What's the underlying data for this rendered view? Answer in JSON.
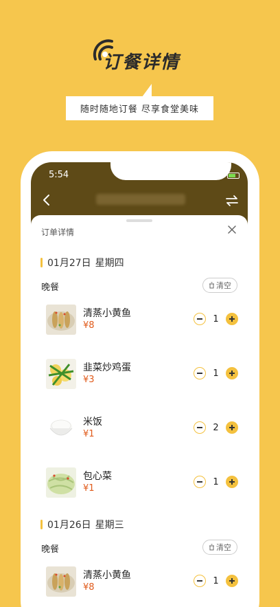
{
  "promo": {
    "title": "订餐详情",
    "subtitle": "随时随地订餐  尽享食堂美味"
  },
  "status_bar": {
    "time": "5:54",
    "network": "4G"
  },
  "nav": {
    "back_icon": "chevron-left-icon",
    "switch_icon": "swap-icon"
  },
  "sheet": {
    "title": "订单详情",
    "close_icon": "close-icon",
    "days": [
      {
        "date": "01月27日",
        "weekday": "星期四",
        "meal": "晚餐",
        "clear_label": "清空",
        "items": [
          {
            "name": "清蒸小黄鱼",
            "price": "¥8",
            "qty": "1",
            "image": "steamed-fish"
          },
          {
            "name": "韭菜炒鸡蛋",
            "price": "¥3",
            "qty": "1",
            "image": "chive-egg"
          },
          {
            "name": "米饭",
            "price": "¥1",
            "qty": "2",
            "image": "rice"
          },
          {
            "name": "包心菜",
            "price": "¥1",
            "qty": "1",
            "image": "cabbage"
          }
        ]
      },
      {
        "date": "01月26日",
        "weekday": "星期三",
        "meal": "晚餐",
        "clear_label": "清空",
        "items": [
          {
            "name": "清蒸小黄鱼",
            "price": "¥8",
            "qty": "1",
            "image": "steamed-fish"
          }
        ]
      }
    ]
  },
  "colors": {
    "background": "#f6c64d",
    "accent": "#f4c13e",
    "header": "#5e4a17",
    "price": "#e05a1a"
  }
}
